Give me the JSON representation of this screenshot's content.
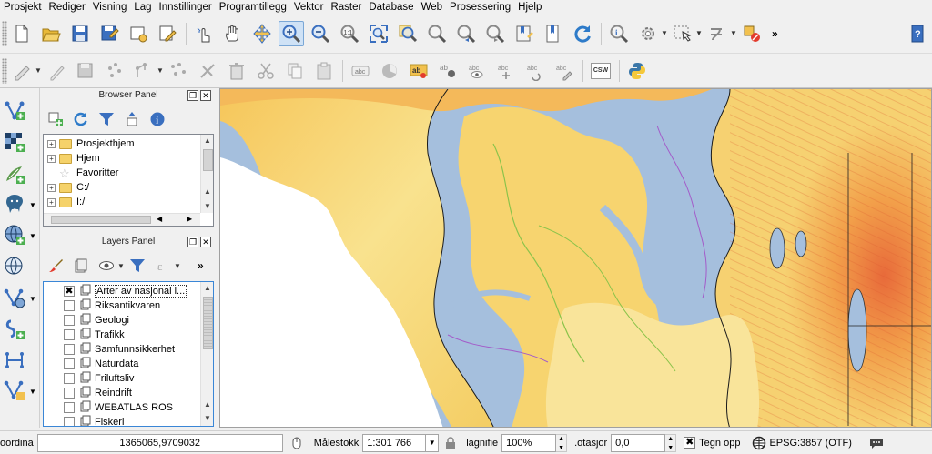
{
  "menubar": {
    "items": [
      "Prosjekt",
      "Rediger",
      "Visning",
      "Lag",
      "Innstillinger",
      "Programtillegg",
      "Vektor",
      "Raster",
      "Database",
      "Web",
      "Prosessering",
      "Hjelp"
    ]
  },
  "toolbar1": {
    "icons": [
      "new-project-icon",
      "open-project-icon",
      "save-project-icon",
      "save-as-icon",
      "new-print-composer-icon",
      "composer-manager-icon",
      "touch-zoom-icon",
      "pan-icon",
      "pan-to-selection-icon",
      "zoom-in-icon",
      "zoom-out-icon",
      "zoom-actual-size-icon",
      "zoom-full-icon",
      "zoom-to-selection-icon",
      "zoom-to-layer-icon",
      "zoom-last-icon",
      "zoom-next-icon",
      "new-bookmark-icon",
      "show-bookmarks-icon",
      "refresh-icon",
      "identify-icon",
      "action-icon",
      "select-icon",
      "deselect-icon",
      "measure-icon",
      "help-icon"
    ],
    "overflow": "»"
  },
  "toolbar2": {
    "icons": [
      "current-edits-icon",
      "toggle-editing-icon",
      "save-edits-icon",
      "add-feature-icon",
      "move-feature-icon",
      "node-tool-icon",
      "delete-selected-icon",
      "cut-features-icon",
      "copy-features-icon",
      "paste-features-icon",
      "label-icon",
      "diagram-icon",
      "label-highlight-icon",
      "pin-label-icon",
      "show-hide-label-icon",
      "move-label-icon",
      "rotate-label-icon",
      "change-label-icon",
      "csw-icon",
      "python-icon"
    ],
    "csw_label": "CSW"
  },
  "left_toolbar": {
    "icons": [
      "add-vector-layer-icon",
      "add-raster-layer-icon",
      "add-spatialite-layer-icon",
      "add-postgis-layer-icon",
      "add-wms-layer-icon",
      "add-wfs-layer-icon",
      "add-wcs-layer-icon",
      "add-delimited-text-icon",
      "add-virtual-layer-icon",
      "new-shapefile-icon"
    ]
  },
  "browser_panel": {
    "title": "Browser Panel",
    "items": [
      {
        "label": "Prosjekthjem",
        "type": "folder"
      },
      {
        "label": "Hjem",
        "type": "folder"
      },
      {
        "label": "Favoritter",
        "type": "favorite"
      },
      {
        "label": "C:/",
        "type": "folder"
      },
      {
        "label": "I:/",
        "type": "folder"
      }
    ]
  },
  "layers_panel": {
    "title": "Layers Panel",
    "overflow": "»",
    "layers": [
      {
        "label": "Arter av nasjonal i...",
        "checked": true
      },
      {
        "label": "Riksantikvaren",
        "checked": false
      },
      {
        "label": "Geologi",
        "checked": false
      },
      {
        "label": "Trafikk",
        "checked": false
      },
      {
        "label": "Samfunnsikkerhet",
        "checked": false
      },
      {
        "label": "Naturdata",
        "checked": false
      },
      {
        "label": "Friluftsliv",
        "checked": false
      },
      {
        "label": "Reindrift",
        "checked": false
      },
      {
        "label": "WEBATLAS ROS",
        "checked": false
      },
      {
        "label": "Fiskeri",
        "checked": false
      }
    ]
  },
  "statusbar": {
    "coord_label": "oordina",
    "coord_value": "1365065,9709032",
    "scale_label": "Målestokk",
    "scale_value": "1:301 766",
    "magnifier_label": "lagnifie",
    "magnifier_value": "100%",
    "rotation_label": ".otasjor",
    "rotation_value": "0,0",
    "render_label": "Tegn opp",
    "render_checked": "✖",
    "crs_label": "EPSG:3857 (OTF)"
  },
  "colors": {
    "water": "#a5bfdd",
    "terrain_low": "#f9ecae",
    "terrain_mid": "#f3c34a",
    "terrain_high": "#e8733a",
    "accent": "#3a6fbf"
  }
}
